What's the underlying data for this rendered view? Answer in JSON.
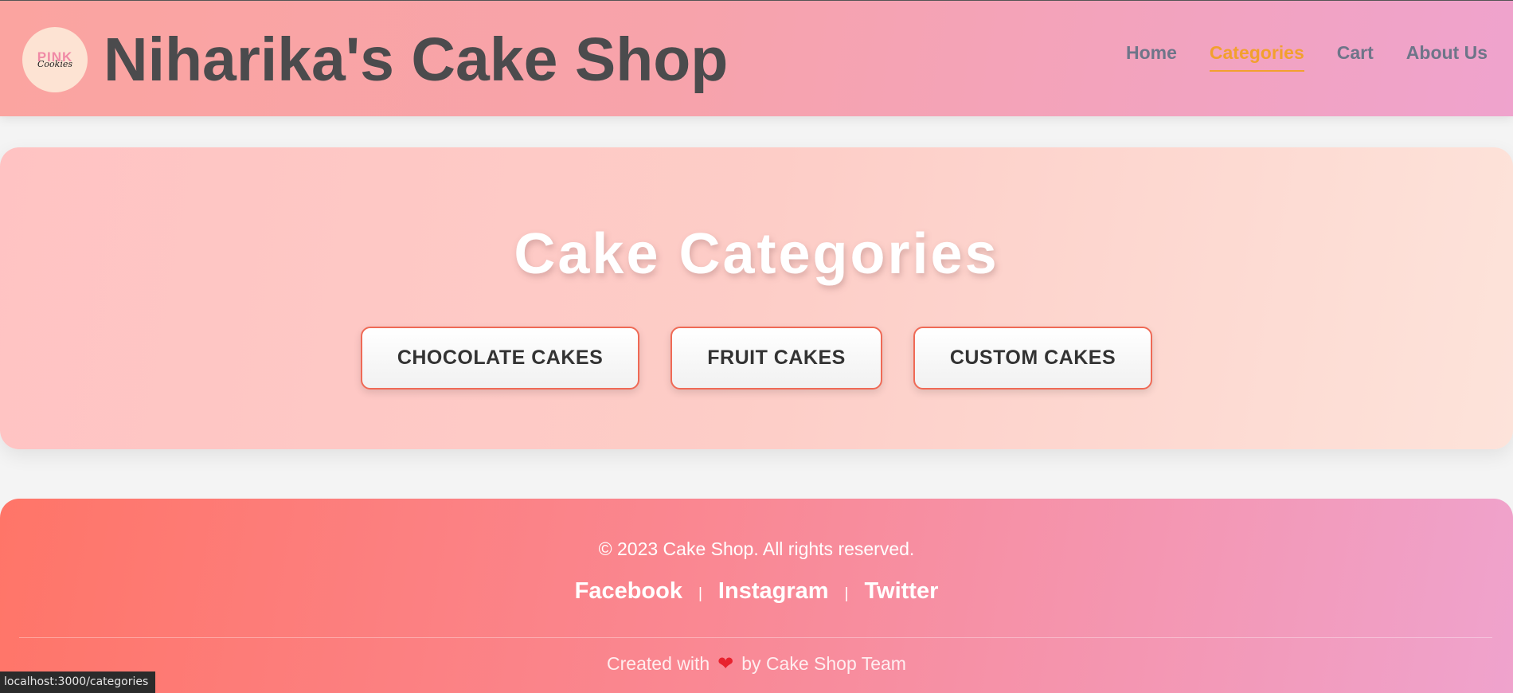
{
  "header": {
    "logo_top": "PINK",
    "logo_bottom": "Cookies",
    "title": "Niharika's Cake Shop",
    "nav": [
      "Home",
      "Categories",
      "Cart",
      "About Us"
    ],
    "active_nav": "Categories"
  },
  "hero": {
    "title": "Cake Categories",
    "categories": [
      "CHOCOLATE CAKES",
      "FRUIT CAKES",
      "CUSTOM CAKES"
    ]
  },
  "footer": {
    "copyright": "© 2023 Cake Shop. All rights reserved.",
    "social": [
      "Facebook",
      "Instagram",
      "Twitter"
    ],
    "separator": "|",
    "credit_prefix": "Created with",
    "credit_heart": "❤",
    "credit_suffix": "by Cake Shop Team"
  },
  "status_url": "localhost:3000/categories",
  "colors": {
    "accent": "#f2a02e",
    "button_border": "#ef6a56",
    "title_text": "#4b4b4d"
  }
}
